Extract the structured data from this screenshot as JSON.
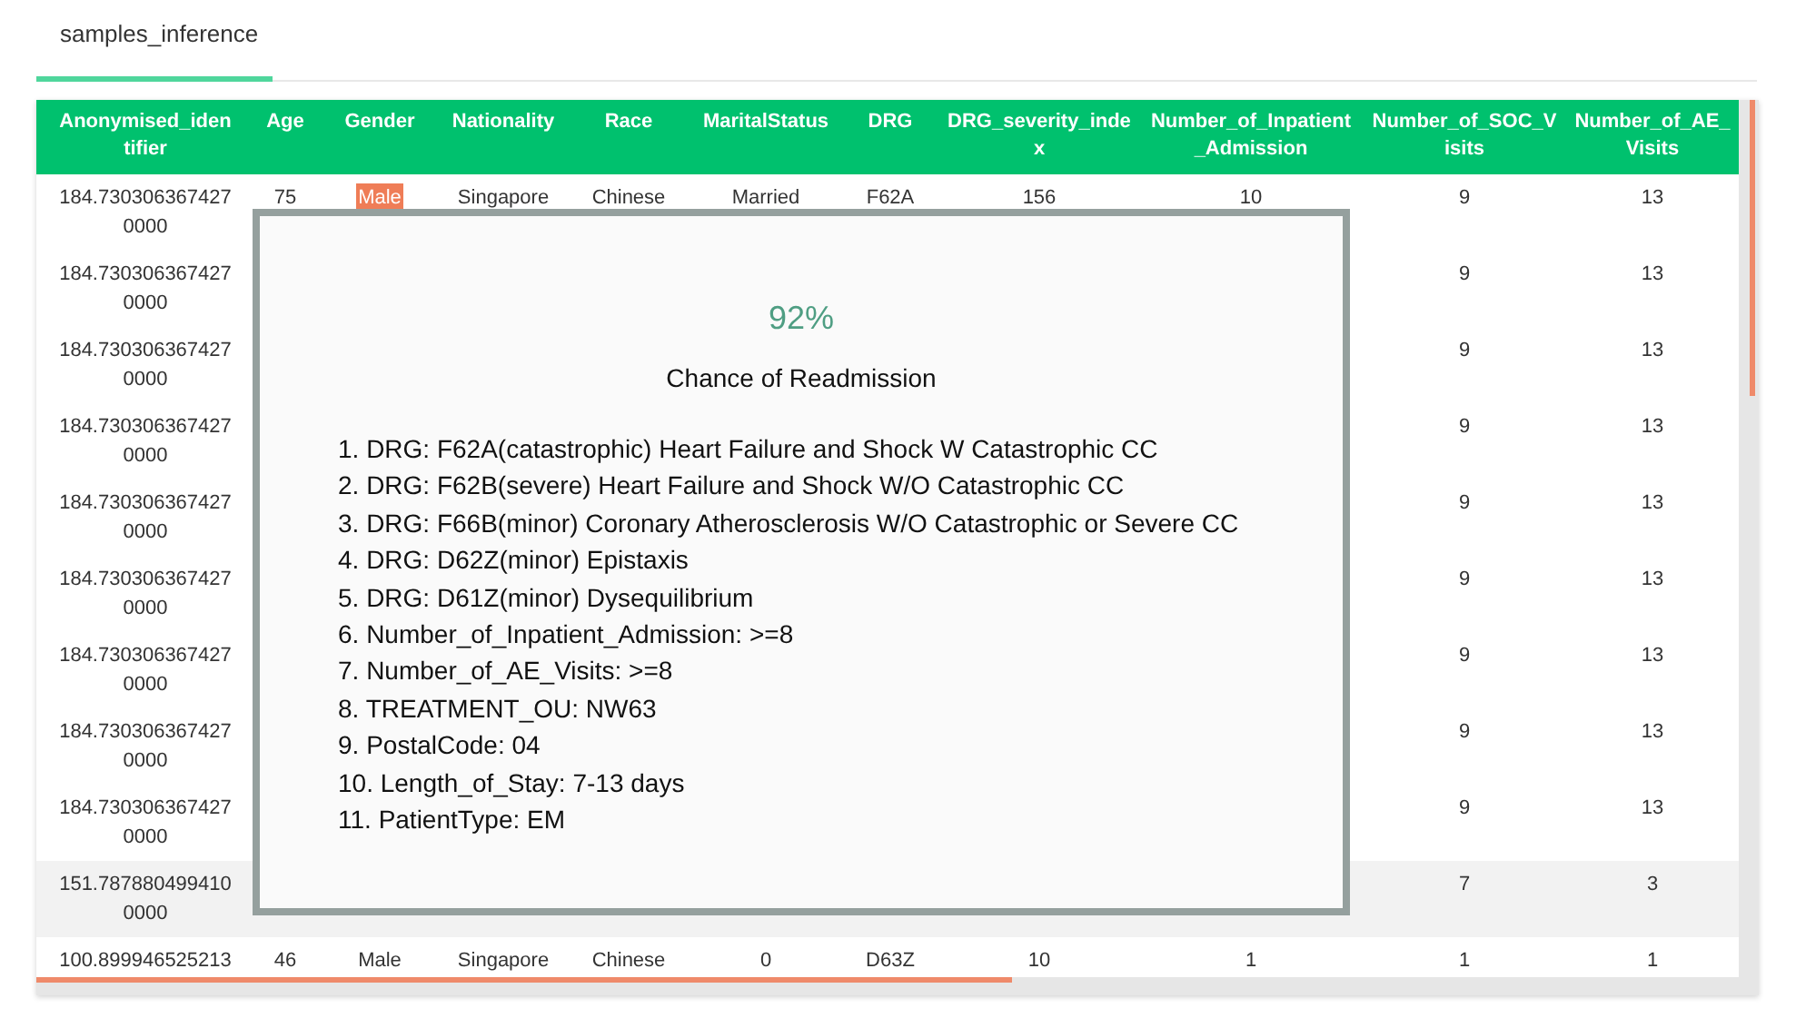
{
  "tabs": [
    {
      "label": "samples_inference",
      "selected": true
    }
  ],
  "table": {
    "columns": [
      "Anonymised_identifier",
      "Age",
      "Gender",
      "Nationality",
      "Race",
      "MaritalStatus",
      "DRG",
      "DRG_severity_index",
      "Number_of_Inpatient_Admission",
      "Number_of_SOC_Visits",
      "Number_of_AE_Visits"
    ],
    "rows": [
      {
        "highlighted": false,
        "cells": [
          "184.7303063674270000",
          "75",
          {
            "text": "Male",
            "flagged": true
          },
          "Singapore",
          "Chinese",
          "Married",
          "F62A",
          "156",
          "10",
          "9",
          "13"
        ]
      },
      {
        "highlighted": false,
        "cells": [
          "184.7303063674270000",
          null,
          null,
          null,
          null,
          null,
          null,
          null,
          null,
          "9",
          "13"
        ]
      },
      {
        "highlighted": false,
        "cells": [
          "184.7303063674270000",
          null,
          null,
          null,
          null,
          null,
          null,
          null,
          null,
          "9",
          "13"
        ]
      },
      {
        "highlighted": false,
        "cells": [
          "184.7303063674270000",
          null,
          null,
          null,
          null,
          null,
          null,
          null,
          null,
          "9",
          "13"
        ]
      },
      {
        "highlighted": false,
        "cells": [
          "184.7303063674270000",
          null,
          null,
          null,
          null,
          null,
          null,
          null,
          null,
          "9",
          "13"
        ]
      },
      {
        "highlighted": false,
        "cells": [
          "184.7303063674270000",
          null,
          null,
          null,
          null,
          null,
          null,
          null,
          null,
          "9",
          "13"
        ]
      },
      {
        "highlighted": false,
        "cells": [
          "184.7303063674270000",
          null,
          null,
          null,
          null,
          null,
          null,
          null,
          null,
          "9",
          "13"
        ]
      },
      {
        "highlighted": false,
        "cells": [
          "184.7303063674270000",
          null,
          null,
          null,
          null,
          null,
          null,
          null,
          null,
          "9",
          "13"
        ]
      },
      {
        "highlighted": false,
        "cells": [
          "184.7303063674270000",
          null,
          null,
          null,
          null,
          null,
          null,
          null,
          null,
          "9",
          "13"
        ]
      },
      {
        "highlighted": true,
        "cells": [
          "151.7878804994100000",
          null,
          null,
          null,
          null,
          null,
          null,
          null,
          null,
          "7",
          "3"
        ]
      },
      {
        "highlighted": false,
        "cells": [
          "100.899946525213",
          "46",
          "Male",
          "Singapore",
          "Chinese",
          "0",
          "D63Z",
          "10",
          "1",
          "1",
          "1"
        ]
      }
    ]
  },
  "popup": {
    "percentage": "92%",
    "title": "Chance of Readmission",
    "reasons": [
      "1. DRG: F62A(catastrophic) Heart Failure and Shock W Catastrophic CC",
      "2. DRG: F62B(severe) Heart Failure and Shock W/O Catastrophic CC",
      "3. DRG: F66B(minor) Coronary Atherosclerosis W/O Catastrophic or Severe CC",
      "4. DRG: D62Z(minor) Epistaxis",
      "5. DRG: D61Z(minor) Dysequilibrium",
      "6. Number_of_Inpatient_Admission: >=8",
      "7. Number_of_AE_Visits: >=8",
      "8. TREATMENT_OU: NW63",
      "9. PostalCode: 04",
      "10. Length_of_Stay: 7-13 days",
      "11. PatientType: EM"
    ]
  }
}
